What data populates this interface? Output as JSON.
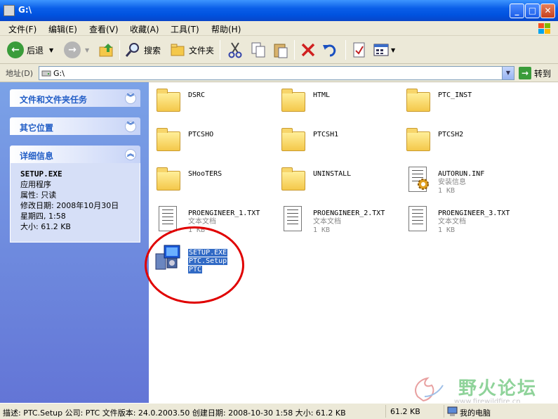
{
  "window": {
    "title": "G:\\"
  },
  "menu": [
    "文件(F)",
    "编辑(E)",
    "查看(V)",
    "收藏(A)",
    "工具(T)",
    "帮助(H)"
  ],
  "toolbar": {
    "back": "后退",
    "search": "搜索",
    "folders": "文件夹"
  },
  "address": {
    "label": "地址(D)",
    "value": "G:\\",
    "go": "转到"
  },
  "sidebar": {
    "tasks_title": "文件和文件夹任务",
    "other_title": "其它位置",
    "details_title": "详细信息",
    "details": {
      "name": "SETUP.EXE",
      "type": "应用程序",
      "attr": "属性: 只读",
      "modified1": "修改日期: 2008年10月30日",
      "modified2": "星期四, 1:58",
      "size": "大小: 61.2 KB"
    }
  },
  "files": [
    {
      "name": "DSRC"
    },
    {
      "name": "HTML"
    },
    {
      "name": "PTC_INST"
    },
    {
      "name": "PTCSHO"
    },
    {
      "name": "PTCSH1"
    },
    {
      "name": "PTCSH2"
    },
    {
      "name": "SHooTERS"
    },
    {
      "name": "UNINSTALL"
    },
    {
      "name": "AUTORUN.INF",
      "type": "安装信息",
      "size": "1 KB"
    },
    {
      "name": "PROENGINEER_1.TXT",
      "type": "文本文档",
      "size": "1 KB"
    },
    {
      "name": "PROENGINEER_2.TXT",
      "type": "文本文档",
      "size": "1 KB"
    },
    {
      "name": "PROENGINEER_3.TXT",
      "type": "文本文档",
      "size": "1 KB"
    },
    {
      "name": "SETUP.EXE",
      "type": "PTC.Setup",
      "size": "PTC"
    }
  ],
  "status": {
    "desc": "描述: PTC.Setup 公司: PTC 文件版本: 24.0.2003.50 创建日期: 2008-10-30 1:58 大小: 61.2 KB",
    "size": "61.2 KB",
    "location": "我的电脑"
  },
  "watermark": {
    "text": "野火论坛",
    "url": "www.firewildfire.cn"
  }
}
